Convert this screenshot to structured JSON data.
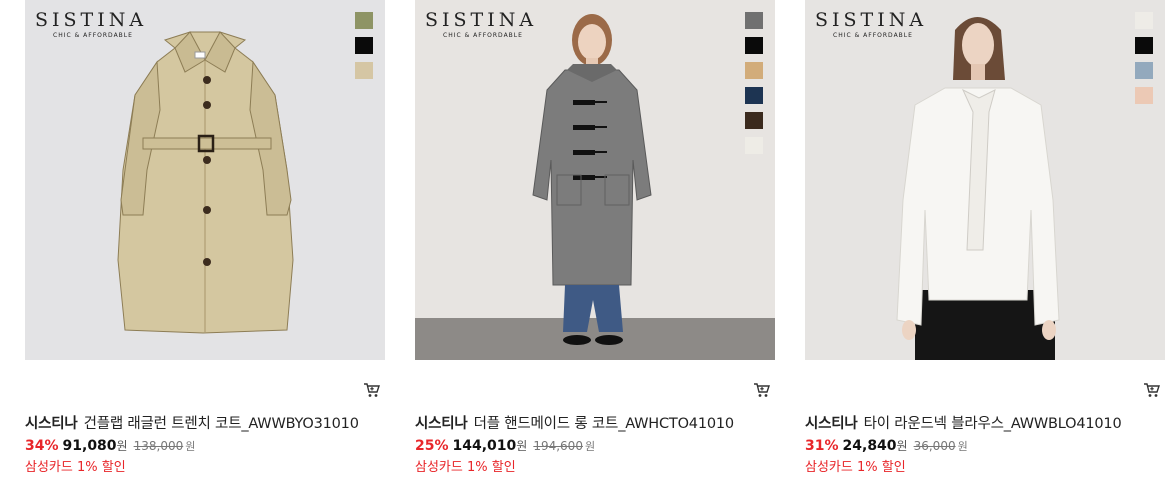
{
  "products": [
    {
      "brand_logo": "SISTINA",
      "brand_logo_sub": "CHIC & AFFORDABLE",
      "swatches": [
        "#8e9465",
        "#0a0a0a",
        "#d5c6a4"
      ],
      "brand": "시스티나",
      "name": "건플랩 래글런 트렌치 코트_AWWBYO31010",
      "discount": "34%",
      "price": "91,080",
      "price_unit": "원",
      "original_price": "138,000",
      "original_unit": "원",
      "card_discount": "삼성카드 1% 할인",
      "image_bg": "#e3e3e5"
    },
    {
      "brand_logo": "SISTINA",
      "brand_logo_sub": "CHIC & AFFORDABLE",
      "swatches": [
        "#707070",
        "#0a0a0a",
        "#d2ac7a",
        "#1d3452",
        "#3b2a1d",
        "#eeece6"
      ],
      "brand": "시스티나",
      "name": "더플 핸드메이드 롱 코트_AWHCTO41010",
      "discount": "25%",
      "price": "144,010",
      "price_unit": "원",
      "original_price": "194,600",
      "original_unit": "원",
      "card_discount": "삼성카드 1% 할인",
      "image_bg": "#e7e4e1"
    },
    {
      "brand_logo": "SISTINA",
      "brand_logo_sub": "CHIC & AFFORDABLE",
      "swatches": [
        "#eeece7",
        "#0a0a0a",
        "#93a9bd",
        "#ecc9b5"
      ],
      "brand": "시스티나",
      "name": "타이 라운드넥 블라우스_AWWBLO41010",
      "discount": "31%",
      "price": "24,840",
      "price_unit": "원",
      "original_price": "36,000",
      "original_unit": "원",
      "card_discount": "삼성카드 1% 할인",
      "image_bg": "#e6e4e2"
    }
  ]
}
